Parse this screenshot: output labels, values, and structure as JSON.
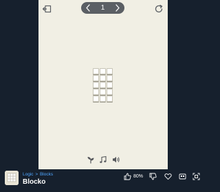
{
  "game": {
    "level": "1",
    "grid_rows": 5,
    "grid_cols": 3
  },
  "top_bar": {
    "back_icon": "back-icon",
    "prev_icon": "chevron-left-icon",
    "next_icon": "chevron-right-icon",
    "reload_icon": "reload-icon"
  },
  "controls": {
    "moves_icon": "sapling-icon",
    "music_icon": "music-note-icon",
    "sound_icon": "speaker-icon"
  },
  "footer": {
    "breadcrumb": {
      "category": "Logic",
      "separator": ">",
      "subcategory": "Blocks"
    },
    "title": "Blocko",
    "like_percent": "80%"
  },
  "colors": {
    "page_background": "#16202d",
    "game_background": "#f1efe4",
    "level_pill": "#5b5f64",
    "link_blue": "#4fa6ff"
  }
}
